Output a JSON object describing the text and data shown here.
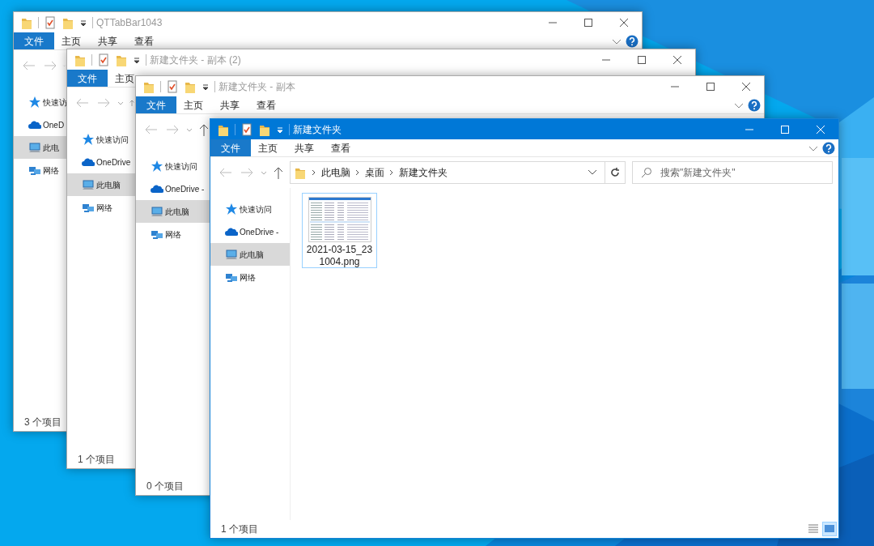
{
  "windows": [
    {
      "title": "QTTabBar1043",
      "active": false,
      "ribbon_tabs": [
        {
          "label": "文件",
          "kind": "file"
        },
        {
          "label": "主页",
          "kind": "tab"
        },
        {
          "label": "共享",
          "kind": "tab"
        },
        {
          "label": "查看",
          "kind": "tab"
        }
      ],
      "nav_items": [
        {
          "label": "快速访",
          "kind": "star",
          "selected": false
        },
        {
          "label": "OneD",
          "kind": "cloud",
          "selected": false
        },
        {
          "label": "此电",
          "kind": "pc",
          "selected": true
        },
        {
          "label": "网络",
          "kind": "network",
          "selected": false
        }
      ],
      "status": "3 个项目"
    },
    {
      "title": "新建文件夹 - 副本 (2)",
      "active": false,
      "ribbon_tabs": [
        {
          "label": "文件",
          "kind": "file"
        },
        {
          "label": "主页",
          "kind": "tab"
        }
      ],
      "nav_items": [
        {
          "label": "快速访问",
          "kind": "star",
          "selected": false
        },
        {
          "label": "OneDrive",
          "kind": "cloud",
          "selected": false
        },
        {
          "label": "此电脑",
          "kind": "pc",
          "selected": true
        },
        {
          "label": "网络",
          "kind": "network",
          "selected": false
        }
      ],
      "status": "1 个项目"
    },
    {
      "title": "新建文件夹 - 副本",
      "active": false,
      "ribbon_tabs": [
        {
          "label": "文件",
          "kind": "file"
        },
        {
          "label": "主页",
          "kind": "tab"
        },
        {
          "label": "共享",
          "kind": "tab"
        },
        {
          "label": "查看",
          "kind": "tab"
        }
      ],
      "nav_items": [
        {
          "label": "快速访问",
          "kind": "star",
          "selected": false
        },
        {
          "label": "OneDrive -",
          "kind": "cloud",
          "selected": false
        },
        {
          "label": "此电脑",
          "kind": "pc",
          "selected": true
        },
        {
          "label": "网络",
          "kind": "network",
          "selected": false
        }
      ],
      "status": "0 个项目"
    },
    {
      "title": "新建文件夹",
      "active": true,
      "ribbon_tabs": [
        {
          "label": "文件",
          "kind": "file"
        },
        {
          "label": "主页",
          "kind": "tab"
        },
        {
          "label": "共享",
          "kind": "tab"
        },
        {
          "label": "查看",
          "kind": "tab"
        }
      ],
      "address": {
        "crumbs": [
          "此电脑",
          "桌面",
          "新建文件夹"
        ]
      },
      "search": {
        "placeholder": "搜索\"新建文件夹\""
      },
      "nav_items": [
        {
          "label": "快速访问",
          "kind": "star",
          "selected": false
        },
        {
          "label": "OneDrive -",
          "kind": "cloud",
          "selected": false
        },
        {
          "label": "此电脑",
          "kind": "pc",
          "selected": true
        },
        {
          "label": "网络",
          "kind": "network",
          "selected": false
        }
      ],
      "files": [
        {
          "name": "2021-03-15_231004.png",
          "focused": true
        }
      ],
      "status": "1 个项目"
    }
  ]
}
